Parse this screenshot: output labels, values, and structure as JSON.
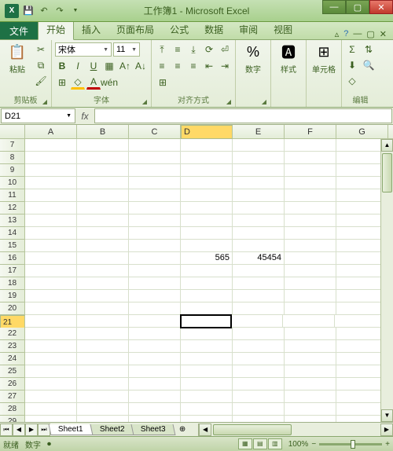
{
  "title": "工作簿1 - Microsoft Excel",
  "tabs": {
    "file": "文件",
    "home": "开始",
    "insert": "插入",
    "layout": "页面布局",
    "formula": "公式",
    "data": "数据",
    "review": "审阅",
    "view": "视图"
  },
  "ribbon": {
    "clipboard": {
      "label": "剪贴板",
      "paste": "粘贴"
    },
    "font": {
      "label": "字体",
      "name": "宋体",
      "size": "11"
    },
    "align": {
      "label": "对齐方式"
    },
    "number": {
      "label": "数字"
    },
    "style": {
      "label": "样式"
    },
    "cells": {
      "label": "单元格"
    },
    "editing": {
      "label": "编辑"
    }
  },
  "namebox": "D21",
  "columns": [
    "A",
    "B",
    "C",
    "D",
    "E",
    "F",
    "G"
  ],
  "rows": [
    7,
    8,
    9,
    10,
    11,
    12,
    13,
    14,
    15,
    16,
    17,
    18,
    19,
    20,
    21,
    22,
    23,
    24,
    25,
    26,
    27,
    28,
    29
  ],
  "active_col": "D",
  "active_row": 21,
  "cells": {
    "D16": "565",
    "E16": "45454"
  },
  "sheets": [
    "Sheet1",
    "Sheet2",
    "Sheet3"
  ],
  "active_sheet": 0,
  "status": {
    "ready": "就绪",
    "mode": "数字",
    "zoom": "100%"
  }
}
